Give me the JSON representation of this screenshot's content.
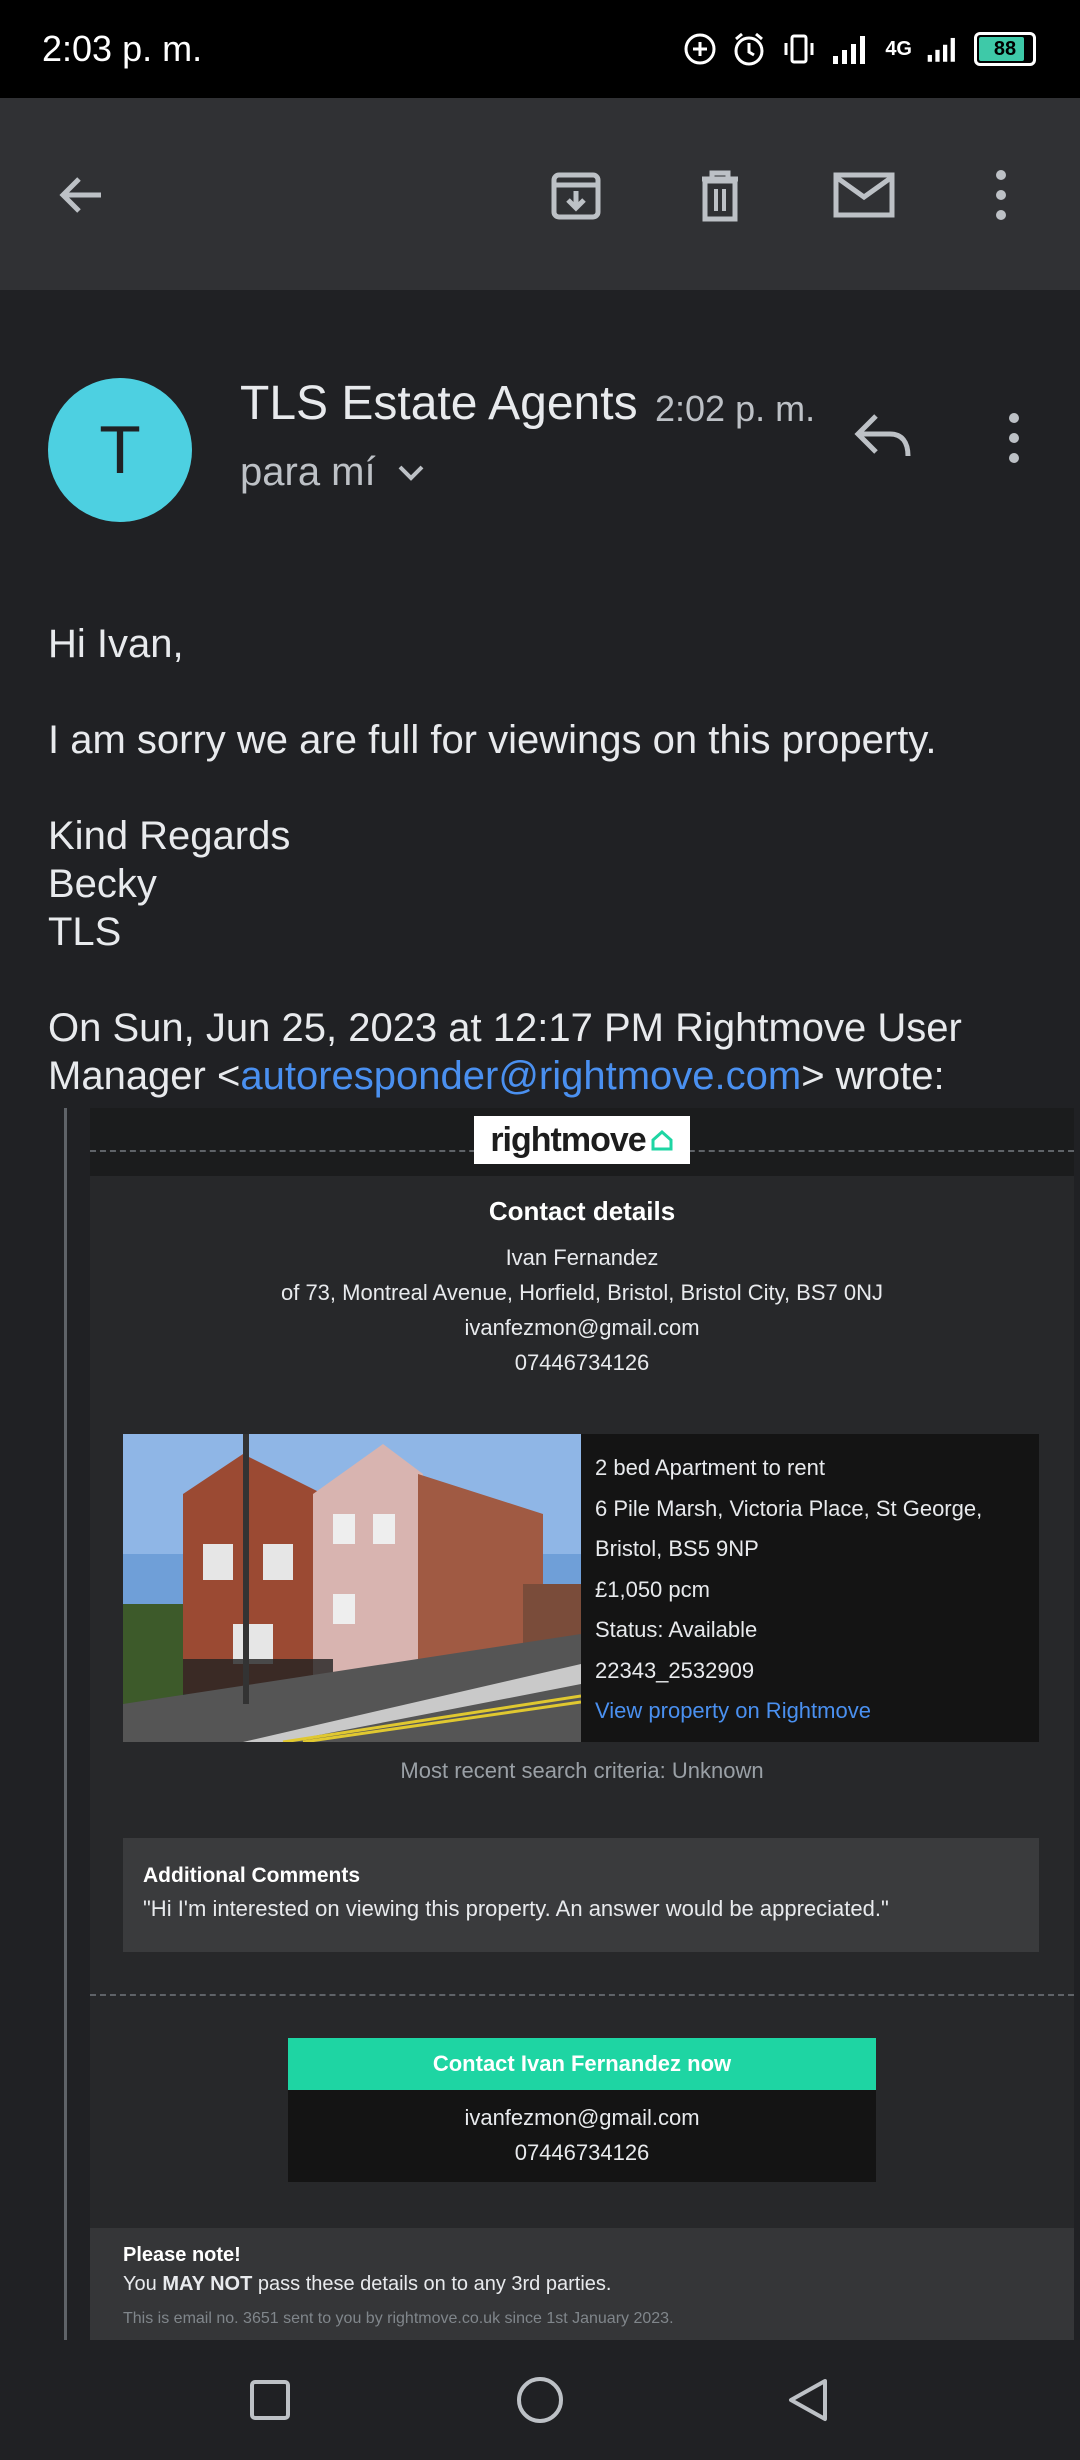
{
  "status_bar": {
    "time": "2:03 p. m.",
    "network": "4G",
    "battery": "88",
    "battery_level": 0.88
  },
  "app_bar": {
    "back_icon": "arrow-back-icon",
    "archive_icon": "archive-icon",
    "delete_icon": "trash-icon",
    "mark_unread_icon": "mail-icon",
    "more_icon": "more-vert-icon"
  },
  "email": {
    "avatar_letter": "T",
    "sender": "TLS Estate Agents",
    "time": "2:02 p. m.",
    "recipient": "para mí",
    "reply_icon": "reply-icon",
    "greeting": "Hi Ivan,",
    "message": "I am sorry we are full for viewings on this property.",
    "sign_off": [
      "Kind Regards",
      "Becky",
      "TLS"
    ],
    "quote_intro": "On Sun, Jun 25, 2023 at 12:17 PM Rightmove User Manager <",
    "quote_email": "autoresponder@rightmove.com",
    "quote_outro": "> wrote:"
  },
  "rightmove": {
    "logo_text": "rightmove",
    "contact_title": "Contact details",
    "contact": {
      "name": "Ivan Fernandez",
      "address": "of 73, Montreal Avenue, Horfield, Bristol, Bristol City, BS7 0NJ",
      "email": "ivanfezmon@gmail.com",
      "phone": "07446734126"
    },
    "property": {
      "type": "2 bed Apartment to rent",
      "address_line1": "6 Pile Marsh, Victoria Place, St George,",
      "address_line2": "Bristol, BS5 9NP",
      "price": "£1,050 pcm",
      "status": "Status: Available",
      "ref": "22343_2532909",
      "link": "View property on Rightmove"
    },
    "search_criteria": "Most recent search criteria: Unknown",
    "comments_title": "Additional Comments",
    "comments_text": "\"Hi I'm interested on viewing this property. An answer would be appreciated.\"",
    "contact_button": "Contact Ivan Fernandez now",
    "contact_email": "ivanfezmon@gmail.com",
    "contact_phone": "07446734126",
    "note_title": "Please note!",
    "note_prefix": "You ",
    "note_bold": "MAY NOT",
    "note_suffix": " pass these details on to any 3rd parties.",
    "note_small": "This is email no. 3651 sent to you by rightmove.co.uk since 1st January 2023."
  },
  "nav_bar": {
    "recents_icon": "square-icon",
    "home_icon": "circle-icon",
    "back_icon": "triangle-back-icon"
  }
}
